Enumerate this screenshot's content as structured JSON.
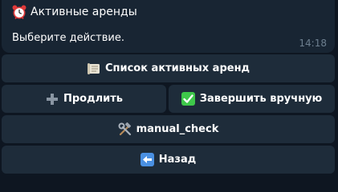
{
  "message": {
    "title": "Активные аренды",
    "title_icon": "alarm-clock-icon",
    "text": "Выберите действие.",
    "time": "14:18"
  },
  "keyboard": {
    "list_label": "Список активных аренд",
    "list_icon": "scroll-icon",
    "extend_label": "Продлить",
    "extend_icon": "plus-icon",
    "finish_label": "Завершить вручную",
    "finish_icon": "check-mark-icon",
    "manual_check_label": "manual_check",
    "manual_check_icon": "hammer-wrench-icon",
    "back_label": "Назад",
    "back_icon": "left-arrow-icon"
  },
  "colors": {
    "background": "#0e1621",
    "bubble": "#182533",
    "button": "#1e2c3a",
    "time": "#6d7f8f",
    "check_green": "#3ec84a"
  }
}
